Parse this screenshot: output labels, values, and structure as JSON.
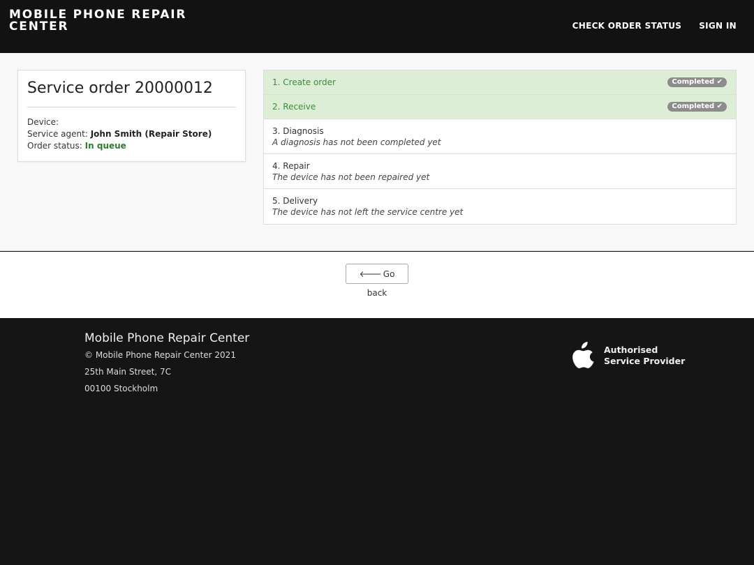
{
  "header": {
    "brand": "MOBILE PHONE REPAIR CENTER",
    "nav": {
      "check_status": "CHECK ORDER STATUS",
      "sign_in": "SIGN IN"
    }
  },
  "order": {
    "title": "Service order 20000012",
    "device_label": "Device:",
    "device_value": "",
    "agent_label": "Service agent:",
    "agent_value": "John Smith (Repair Store)",
    "status_label": "Order status:",
    "status_value": "In queue"
  },
  "steps": [
    {
      "label": "1. Create order",
      "badge": "Completed ✔"
    },
    {
      "label": "2. Receive",
      "badge": "Completed ✔"
    },
    {
      "label": "3. Diagnosis",
      "note": "A diagnosis has not been completed yet"
    },
    {
      "label": "4. Repair",
      "note": "The device has not been repaired yet"
    },
    {
      "label": "5. Delivery",
      "note": "The device has not left the service centre yet"
    }
  ],
  "go_back": {
    "label": "Go back",
    "icon": "arrow-left-icon"
  },
  "footer": {
    "name": "Mobile Phone Repair Center",
    "copyright": "© Mobile Phone Repair Center 2021",
    "street": "25th Main Street,  7C",
    "city": "00100 Stockholm",
    "provider_line1": "Authorised",
    "provider_line2": "Service Provider",
    "provider_icon": "apple-logo-icon"
  },
  "colors": {
    "header_bg": "#121212",
    "completed_bg": "#dcefd6",
    "completed_text": "#3c8a3c",
    "status_green": "#2e7d32",
    "badge_bg": "#8c8c8c"
  }
}
